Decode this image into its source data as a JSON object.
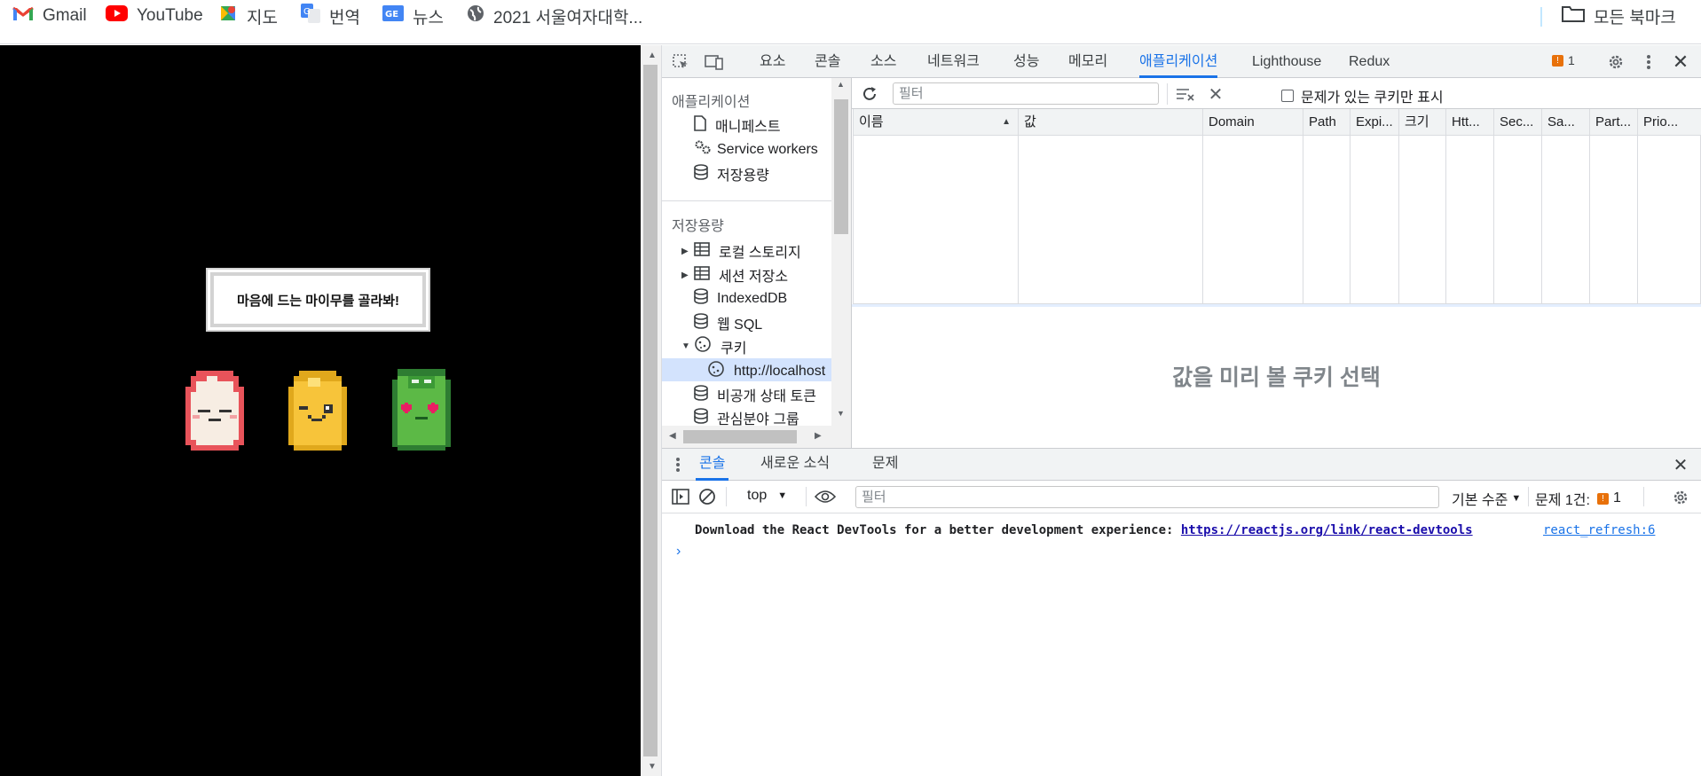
{
  "bookmarks": {
    "items": [
      {
        "label": "Gmail",
        "icon": "gmail-icon"
      },
      {
        "label": "YouTube",
        "icon": "youtube-icon"
      },
      {
        "label": "지도",
        "icon": "maps-icon"
      },
      {
        "label": "번역",
        "icon": "translate-icon"
      },
      {
        "label": "뉴스",
        "icon": "news-icon"
      },
      {
        "label": "2021 서울여자대학...",
        "icon": "globe-icon"
      }
    ],
    "all_bookmarks_label": "모든 북마크"
  },
  "page": {
    "speech_text": "마음에 드는 마이무를 골라봐!",
    "characters": [
      {
        "name": "red",
        "color": "#e8535a"
      },
      {
        "name": "yellow",
        "color": "#f7c43a"
      },
      {
        "name": "green",
        "color": "#5cb946"
      }
    ]
  },
  "devtools": {
    "tabs": [
      "요소",
      "콘솔",
      "소스",
      "네트워크",
      "성능",
      "메모리",
      "애플리케이션",
      "Lighthouse",
      "Redux"
    ],
    "active_tab": "애플리케이션",
    "issues_count": "1",
    "sidebar": {
      "app_header": "애플리케이션",
      "app_items": [
        "매니페스트",
        "Service workers",
        "저장용량"
      ],
      "storage_header": "저장용량",
      "storage_items": [
        "로컬 스토리지",
        "세션 저장소",
        "IndexedDB",
        "웹 SQL",
        "쿠키",
        "http://localhost",
        "비공개 상태 토큰",
        "관심분야 그룹"
      ]
    },
    "cookies": {
      "filter_placeholder": "필터",
      "only_issues_label": "문제가 있는 쿠키만 표시",
      "columns": [
        "이름",
        "값",
        "Domain",
        "Path",
        "Expi...",
        "크기",
        "Htt...",
        "Sec...",
        "Sa...",
        "Part...",
        "Prio..."
      ],
      "preview_text": "값을 미리 볼 쿠키 선택"
    },
    "drawer": {
      "tabs": [
        "콘솔",
        "새로운 소식",
        "문제"
      ],
      "active_tab": "콘솔",
      "context": "top",
      "filter_placeholder": "필터",
      "level": "기본 수준",
      "issues_label": "문제 1건:",
      "issues_count": "1",
      "message_text": "Download the React DevTools for a better development experience: ",
      "message_link": "https://reactjs.org/link/react-devtools",
      "message_source": "react_refresh:6"
    }
  }
}
